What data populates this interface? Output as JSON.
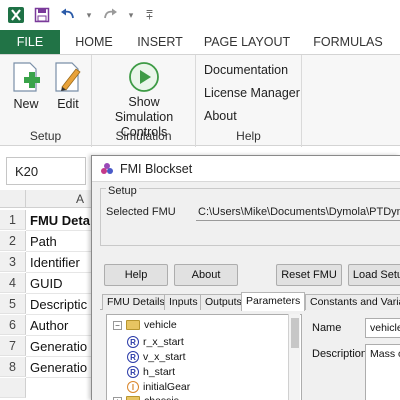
{
  "app": {
    "tabs": [
      "FILE",
      "HOME",
      "INSERT",
      "PAGE LAYOUT",
      "FORMULAS"
    ],
    "accent": "#217346"
  },
  "ribbon": {
    "setup": {
      "new_label": "New",
      "edit_label": "Edit",
      "group_label": "Setup"
    },
    "simulation": {
      "show_label_1": "Show Simulation",
      "show_label_2": "Controls",
      "group_label": "Simulation"
    },
    "help": {
      "links": [
        "Documentation",
        "License Manager",
        "About"
      ],
      "group_label": "Help"
    }
  },
  "formula_bar": {
    "name_box": "K20"
  },
  "sheet": {
    "column_header": "A",
    "rows": [
      {
        "num": "1",
        "text": "FMU Deta",
        "bold": true
      },
      {
        "num": "2",
        "text": "Path",
        "bold": false
      },
      {
        "num": "3",
        "text": "Identifier",
        "bold": false
      },
      {
        "num": "4",
        "text": "GUID",
        "bold": false
      },
      {
        "num": "5",
        "text": "Descriptic",
        "bold": false
      },
      {
        "num": "6",
        "text": "Author",
        "bold": false
      },
      {
        "num": "7",
        "text": "Generatio",
        "bold": false
      },
      {
        "num": "8",
        "text": "Generatio",
        "bold": false
      }
    ]
  },
  "dialog": {
    "title": "FMI Blockset",
    "setup_label": "Setup",
    "selected_fmu_label": "Selected FMU",
    "selected_fmu_value": "C:\\Users\\Mike\\Documents\\Dymola\\PTDynamics_",
    "buttons": {
      "help": "Help",
      "about": "About",
      "reset": "Reset FMU",
      "load": "Load Setup"
    },
    "tabs": [
      "FMU Details",
      "Inputs",
      "Outputs",
      "Parameters",
      "Constants and Variabl"
    ],
    "active_tab": "Parameters",
    "tree": {
      "vehicle": "vehicle",
      "items": [
        {
          "badge": "R",
          "label": "r_x_start"
        },
        {
          "badge": "R",
          "label": "v_x_start"
        },
        {
          "badge": "R",
          "label": "h_start"
        },
        {
          "badge": "I",
          "label": "initialGear"
        }
      ],
      "chassis": "chassis"
    },
    "properties": {
      "name_label": "Name",
      "name_value": "vehicle.",
      "description_label": "Description",
      "description_value": "Mass o"
    }
  }
}
